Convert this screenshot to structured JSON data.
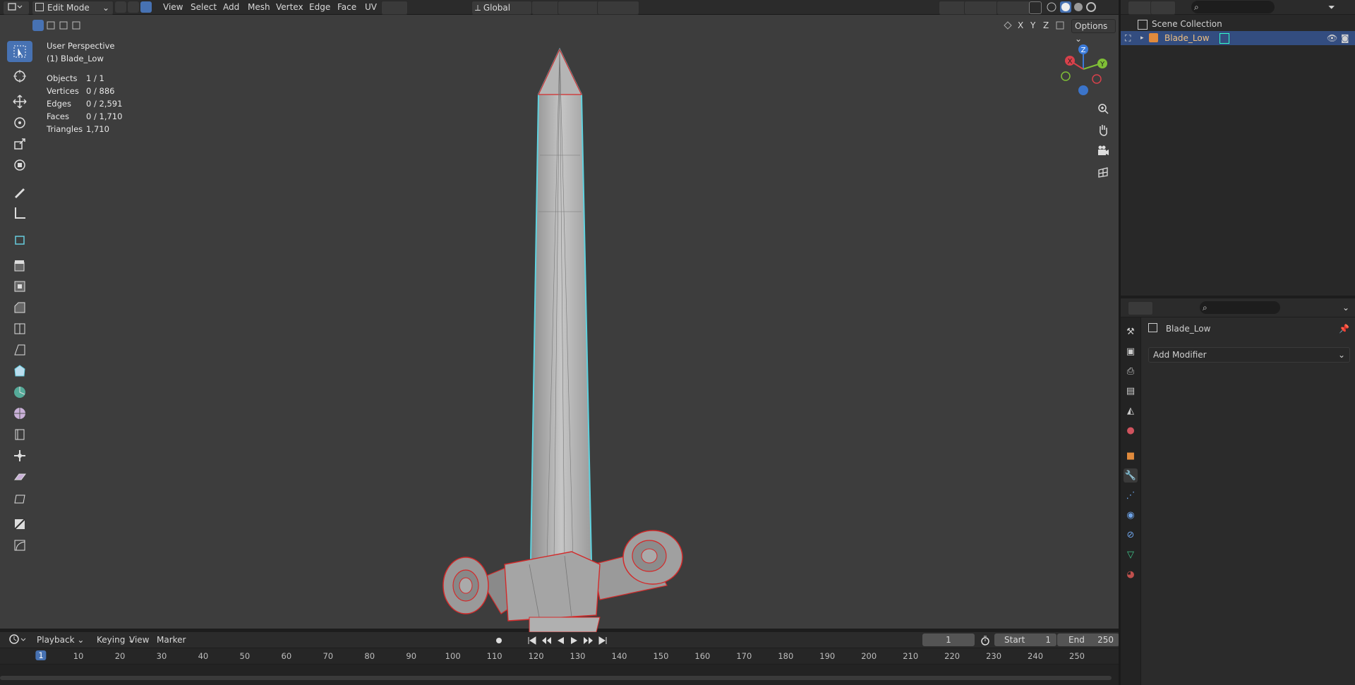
{
  "header": {
    "mode": "Edit Mode",
    "menus": [
      "View",
      "Select",
      "Add",
      "Mesh",
      "Vertex",
      "Edge",
      "Face",
      "UV"
    ],
    "orientation": "Global",
    "options_label": "Options",
    "axes": [
      "X",
      "Y",
      "Z"
    ]
  },
  "overlay": {
    "perspective": "User Perspective",
    "object": "(1) Blade_Low",
    "stats": [
      {
        "label": "Objects",
        "value": "1 / 1"
      },
      {
        "label": "Vertices",
        "value": "0 / 886"
      },
      {
        "label": "Edges",
        "value": "0 / 2,591"
      },
      {
        "label": "Faces",
        "value": "0 / 1,710"
      },
      {
        "label": "Triangles",
        "value": "1,710"
      }
    ]
  },
  "gizmo": {
    "x": "X",
    "y": "Y",
    "z": "Z"
  },
  "timeline": {
    "menus": [
      "Playback",
      "Keying",
      "View",
      "Marker"
    ],
    "current_frame": "1",
    "start_label": "Start",
    "start_value": "1",
    "end_label": "End",
    "end_value": "250",
    "ticks": [
      "1",
      "10",
      "20",
      "30",
      "40",
      "50",
      "60",
      "70",
      "80",
      "90",
      "100",
      "110",
      "120",
      "130",
      "140",
      "150",
      "160",
      "170",
      "180",
      "190",
      "200",
      "210",
      "220",
      "230",
      "240",
      "250"
    ]
  },
  "outliner": {
    "collection": "Scene Collection",
    "object": "Blade_Low"
  },
  "properties": {
    "object_name": "Blade_Low",
    "add_modifier": "Add Modifier"
  },
  "colors": {
    "accent": "#4772b3",
    "viewport_bg": "#3d3d3d",
    "selection_cyan": "#5fd3e0",
    "wire_red": "#d32a2a"
  }
}
